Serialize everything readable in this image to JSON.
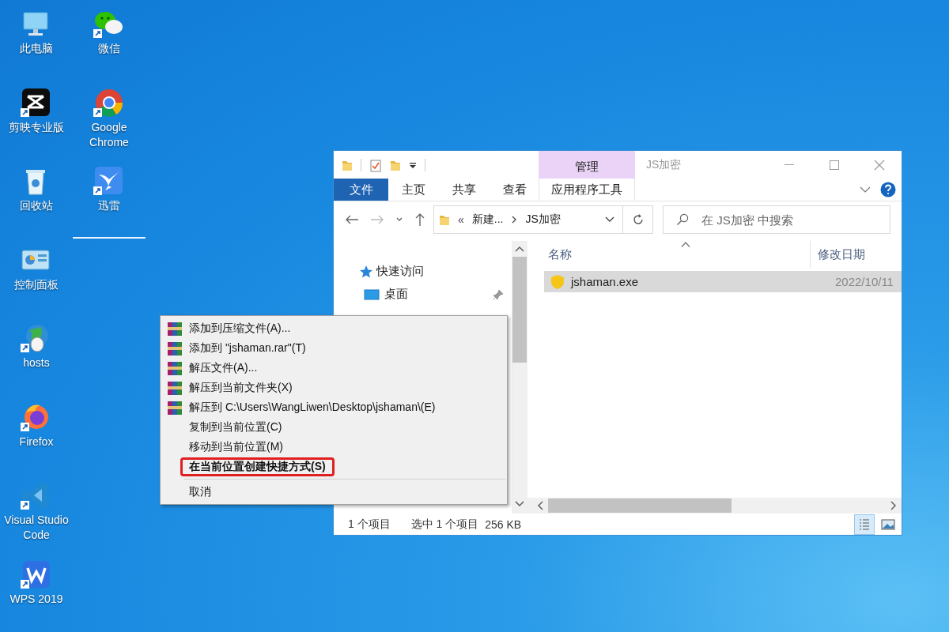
{
  "desktop": {
    "columns": [
      [
        {
          "label": "此电脑",
          "kind": "computer",
          "shortcut": false
        },
        {
          "label": "剪映专业版",
          "kind": "capcut",
          "shortcut": true
        },
        {
          "label": "回收站",
          "kind": "recycle",
          "shortcut": false
        },
        {
          "label": "控制面板",
          "kind": "control-panel",
          "shortcut": false
        },
        {
          "label": "hosts",
          "kind": "globe",
          "shortcut": true
        },
        {
          "label": "Firefox",
          "kind": "firefox",
          "shortcut": true
        },
        {
          "label": "Visual Studio Code",
          "kind": "vscode",
          "shortcut": true
        },
        {
          "label": "WPS 2019",
          "kind": "wps",
          "shortcut": true
        }
      ],
      [
        {
          "label": "微信",
          "kind": "wechat",
          "shortcut": true
        },
        {
          "label": "Google Chrome",
          "kind": "chrome",
          "shortcut": true
        },
        {
          "label": "迅雷",
          "kind": "bird",
          "shortcut": true
        }
      ]
    ]
  },
  "explorer": {
    "context_group": "管理",
    "title": "JS加密",
    "ribbon_tabs": [
      {
        "label": "文件",
        "kind": "file"
      },
      {
        "label": "主页",
        "kind": "tab"
      },
      {
        "label": "共享",
        "kind": "tab"
      },
      {
        "label": "查看",
        "kind": "tab"
      },
      {
        "label": "应用程序工具",
        "kind": "contextual"
      }
    ],
    "address": {
      "overflow": "«",
      "crumbs": [
        "新建...",
        "JS加密"
      ]
    },
    "search": {
      "placeholder": "在 JS加密 中搜索"
    },
    "nav": [
      {
        "label": "快速访问",
        "kind": "star",
        "pinned": false,
        "children": [
          {
            "label": "桌面",
            "kind": "desktop",
            "pinned": true
          }
        ]
      }
    ],
    "columns": [
      {
        "label": "名称",
        "sorted": true
      },
      {
        "label": "修改日期",
        "sorted": false
      }
    ],
    "files": [
      {
        "name": "jshaman.exe",
        "date": "2022/10/11",
        "selected": true
      }
    ],
    "status": {
      "count": "1 个项目",
      "selection": "选中 1 个项目",
      "size": "256 KB"
    },
    "views": [
      {
        "kind": "details",
        "selected": true
      },
      {
        "kind": "large-icons",
        "selected": false
      }
    ]
  },
  "context_menu": {
    "items": [
      {
        "kind": "rar",
        "label": "添加到压缩文件(A)...",
        "default": false,
        "outlined": false
      },
      {
        "kind": "rar",
        "label": "添加到 \"jshaman.rar\"(T)",
        "default": false,
        "outlined": false
      },
      {
        "kind": "rar",
        "label": "解压文件(A)...",
        "default": false,
        "outlined": false
      },
      {
        "kind": "rar",
        "label": "解压到当前文件夹(X)",
        "default": false,
        "outlined": false
      },
      {
        "kind": "rar",
        "label": "解压到 C:\\Users\\WangLiwen\\Desktop\\jshaman\\(E)",
        "default": false,
        "outlined": false
      },
      {
        "kind": "plain",
        "label": "复制到当前位置(C)",
        "default": false,
        "outlined": false
      },
      {
        "kind": "plain",
        "label": "移动到当前位置(M)",
        "default": false,
        "outlined": false
      },
      {
        "kind": "plain",
        "label": "在当前位置创建快捷方式(S)",
        "default": true,
        "outlined": true
      },
      {
        "kind": "separator"
      },
      {
        "kind": "plain",
        "label": "取消",
        "default": false,
        "outlined": false
      }
    ]
  }
}
